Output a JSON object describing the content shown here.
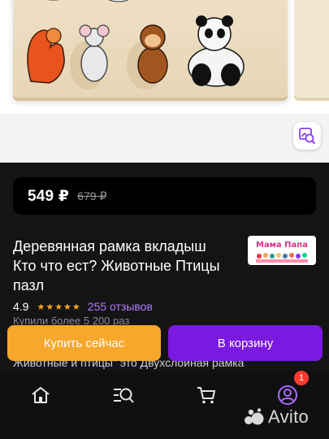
{
  "product": {
    "price": "549 ₽",
    "old_price": "679 ₽",
    "title": "Деревянная рамка вкладыш Кто что ест? Животные Птицы пазл",
    "rating": "4.9",
    "stars": "★★★★★",
    "reviews": "255 отзывов",
    "bought": "Купили более 5 200 раз",
    "description_snippet": "Животные и птицы\" это Двухслойная рамка"
  },
  "seller": {
    "logo_text": "Мама Папа"
  },
  "actions": {
    "buy_label": "Купить сейчас",
    "cart_label": "В корзину"
  },
  "nav": {
    "items": [
      "home-icon",
      "search-icon",
      "cart-icon",
      "profile-icon"
    ],
    "profile_badge": "1"
  },
  "brand": {
    "name": "Avito"
  },
  "colors": {
    "buy": "#f7a72b",
    "cart": "#7a1ae0",
    "reviews": "#b37cff",
    "stars": "#f5a623",
    "badge": "#ff3b30"
  }
}
